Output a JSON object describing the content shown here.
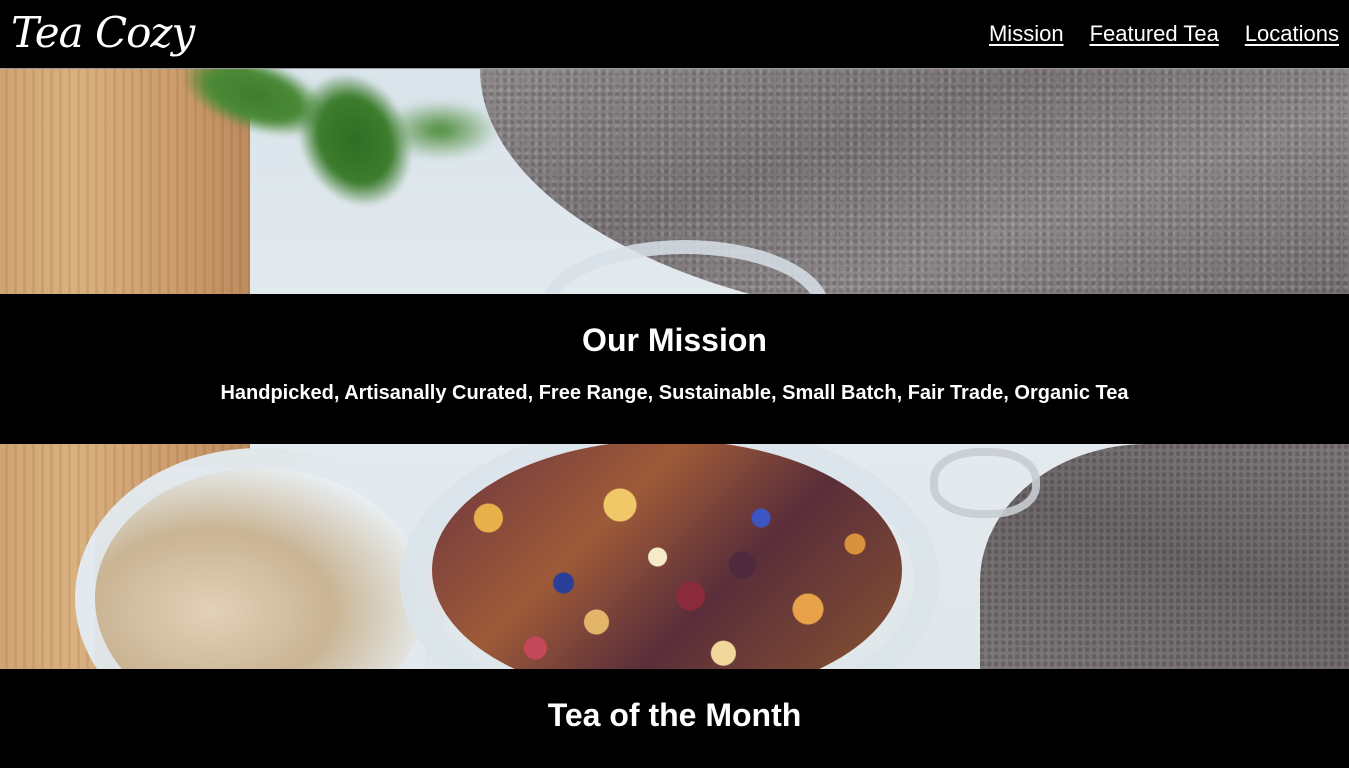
{
  "header": {
    "logo": "Tea Cozy",
    "nav": [
      {
        "label": "Mission"
      },
      {
        "label": "Featured Tea"
      },
      {
        "label": "Locations"
      }
    ]
  },
  "mission": {
    "title": "Our Mission",
    "tagline": "Handpicked, Artisanally Curated, Free Range, Sustainable, Small Batch, Fair Trade, Organic Tea"
  },
  "tea_of_month": {
    "title": "Tea of the Month"
  },
  "colors": {
    "background": "#000000",
    "text": "#ffffff"
  }
}
